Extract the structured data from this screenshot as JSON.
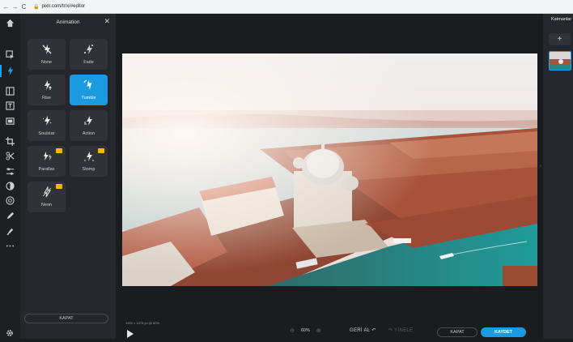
{
  "browser": {
    "back": "←",
    "forward": "→",
    "reload": "C",
    "url": "pixlr.com/tr/x/#editor"
  },
  "toolbar": {
    "tools": [
      "home-icon",
      "arrange-icon",
      "animate-icon",
      "layout-icon",
      "text-icon",
      "frame-icon",
      "crop-icon",
      "cutout-icon",
      "adjust-icon",
      "filter-icon",
      "retouch-icon",
      "draw-icon",
      "liquify-icon",
      "more-icon"
    ]
  },
  "panel": {
    "title": "Animation",
    "close": "✕",
    "tiles": [
      {
        "label": "None",
        "selected": false,
        "premium": false
      },
      {
        "label": "Fade",
        "selected": false,
        "premium": false
      },
      {
        "label": "Rise",
        "selected": false,
        "premium": false
      },
      {
        "label": "Tumble",
        "selected": true,
        "premium": false
      },
      {
        "label": "Soulstar",
        "selected": false,
        "premium": false
      },
      {
        "label": "Action",
        "selected": false,
        "premium": false
      },
      {
        "label": "Parallax",
        "selected": false,
        "premium": true
      },
      {
        "label": "Stomp",
        "selected": false,
        "premium": true
      },
      {
        "label": "Neon",
        "selected": false,
        "premium": true
      }
    ],
    "bottom_button": "KAPAT"
  },
  "canvas": {
    "dims": "1920 × 1078 px @ 60%"
  },
  "layers": {
    "title": "Katmanlar",
    "add": "+"
  },
  "bottom": {
    "zoom_minus": "⊖",
    "zoom_value": "60%",
    "zoom_plus": "⊕",
    "undo": "GERİ AL ↶",
    "redo": "↷ YİNELE",
    "close": "KAPAT",
    "save": "KAYDET"
  },
  "colors": {
    "accent": "#1a9ae0",
    "premium": "#f5b800"
  }
}
